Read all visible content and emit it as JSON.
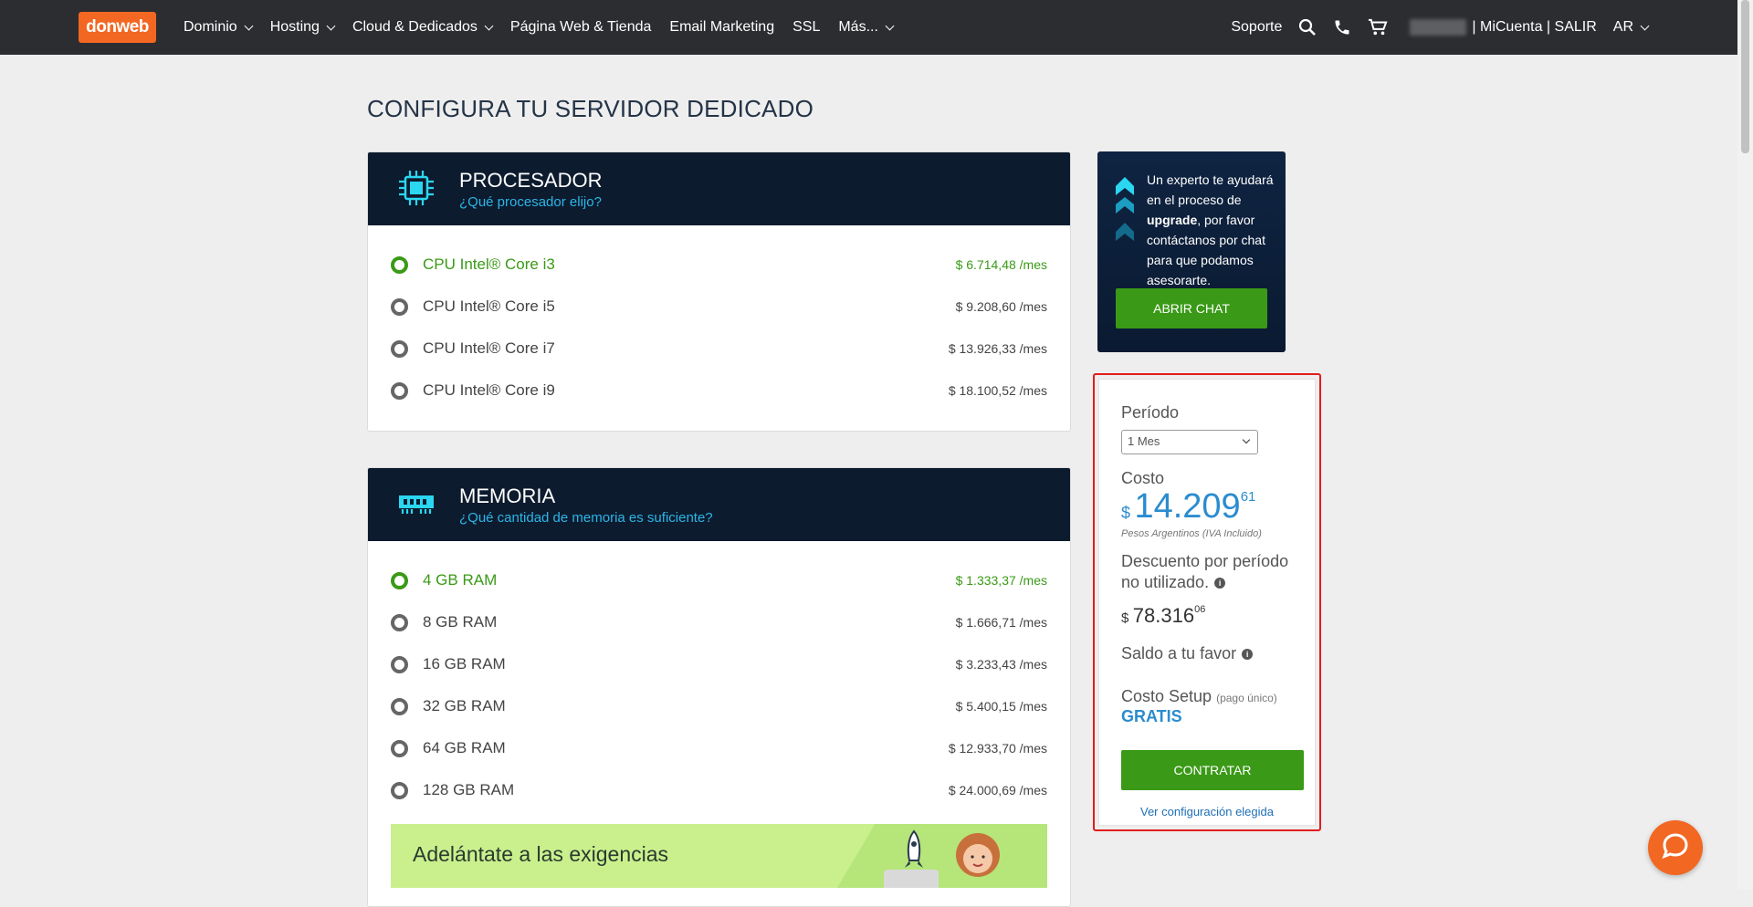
{
  "brand": {
    "logo_text": "donweb",
    "accent": "#f26722"
  },
  "nav": {
    "items": [
      {
        "label": "Dominio",
        "dropdown": true
      },
      {
        "label": "Hosting",
        "dropdown": true
      },
      {
        "label": "Cloud & Dedicados",
        "dropdown": true
      },
      {
        "label": "Página Web & Tienda",
        "dropdown": false
      },
      {
        "label": "Email Marketing",
        "dropdown": false
      },
      {
        "label": "SSL",
        "dropdown": false
      },
      {
        "label": "Más...",
        "dropdown": true
      }
    ],
    "soporte": "Soporte",
    "account": "| MiCuenta | SALIR",
    "country": "AR",
    "icons": [
      "search-icon",
      "phone-icon",
      "cart-icon"
    ]
  },
  "page": {
    "title": "CONFIGURA TU SERVIDOR DEDICADO"
  },
  "procesador": {
    "title": "PROCESADOR",
    "subtitle": "¿Qué procesador elijo?",
    "options": [
      {
        "label": "CPU Intel® Core i3",
        "price": "$ 6.714,48 /mes",
        "selected": true
      },
      {
        "label": "CPU Intel® Core i5",
        "price": "$ 9.208,60 /mes",
        "selected": false
      },
      {
        "label": "CPU Intel® Core i7",
        "price": "$ 13.926,33 /mes",
        "selected": false
      },
      {
        "label": "CPU Intel® Core i9",
        "price": "$ 18.100,52 /mes",
        "selected": false
      }
    ]
  },
  "memoria": {
    "title": "MEMORIA",
    "subtitle": "¿Qué cantidad de memoria es suficiente?",
    "options": [
      {
        "label": "4 GB RAM",
        "price": "$ 1.333,37 /mes",
        "selected": true
      },
      {
        "label": "8 GB RAM",
        "price": "$ 1.666,71 /mes",
        "selected": false
      },
      {
        "label": "16 GB RAM",
        "price": "$ 3.233,43 /mes",
        "selected": false
      },
      {
        "label": "32 GB RAM",
        "price": "$ 5.400,15 /mes",
        "selected": false
      },
      {
        "label": "64 GB RAM",
        "price": "$ 12.933,70 /mes",
        "selected": false
      },
      {
        "label": "128 GB RAM",
        "price": "$ 24.000,69 /mes",
        "selected": false
      }
    ],
    "banner": "Adelántate a las exigencias"
  },
  "expert": {
    "text_before": "Un experto te ayudará en el proceso de ",
    "text_bold": "upgrade",
    "text_after": ", por favor contáctanos por chat para que podamos asesorarte.",
    "button": "ABRIR CHAT"
  },
  "summary": {
    "periodo_label": "Período",
    "periodo_value": "1 Mes",
    "costo_label": "Costo",
    "costo_currency": "$",
    "costo_main": "14.209",
    "costo_cents": "61",
    "costo_note": "Pesos Argentinos (IVA Incluido)",
    "descuento_label_1": "Descuento por período",
    "descuento_label_2": "no utilizado.",
    "descuento_currency": "$",
    "descuento_main": "78.316",
    "descuento_cents": "06",
    "saldo_label": "Saldo a tu favor",
    "setup_label": "Costo Setup",
    "setup_note": "(pago único)",
    "setup_value": "GRATIS",
    "button": "CONTRATAR",
    "link": "Ver configuración elegida"
  },
  "colors": {
    "green": "#3a9a17",
    "navy": "#0d1b2e",
    "link_blue": "#2a8ccf",
    "highlight": "#e21c1c"
  }
}
